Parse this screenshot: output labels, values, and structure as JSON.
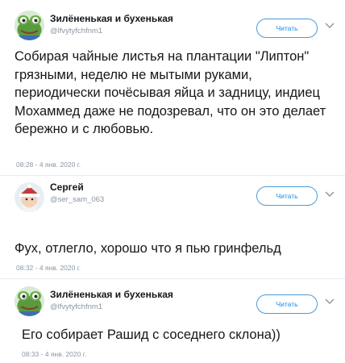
{
  "follow_label": "Читать",
  "tweets": [
    {
      "display_name": "Зилёненькая и бухенькая",
      "handle": "@lfvytyfchfnm1",
      "text": "Собирая чайные листья на плантации \"Липтон\" грязными, неделю не мытыми руками, периодически почёсывая яйца и задницу, индиец Мохаммед даже не подозревал, что он это делает бережно и с любовью.",
      "timestamp": "08:28 - 4 янв. 2020 г.",
      "avatar_icon": "frog-avatar-icon"
    },
    {
      "display_name": "Сергей",
      "handle": "@ser_sam_063",
      "text": "Фух, отлегло, хорошо что я пью гринфельд",
      "emoji": "face-with-tears-of-joy-icon",
      "timestamp": "08:32 - 4 янв. 2020 г.",
      "avatar_icon": "hat-avatar-icon"
    },
    {
      "display_name": "Зилёненькая и бухенькая",
      "handle": "@lfvytyfchfnm1",
      "text": "Его собирает Рашид с соседнего склона))",
      "timestamp": "08:33 - 4 янв. 2020 г.",
      "avatar_icon": "frog-avatar-icon"
    }
  ],
  "colors": {
    "text": "#14171a",
    "muted": "#8a96a3",
    "accent": "#1d8ce0",
    "divider": "#e6ecf0"
  }
}
